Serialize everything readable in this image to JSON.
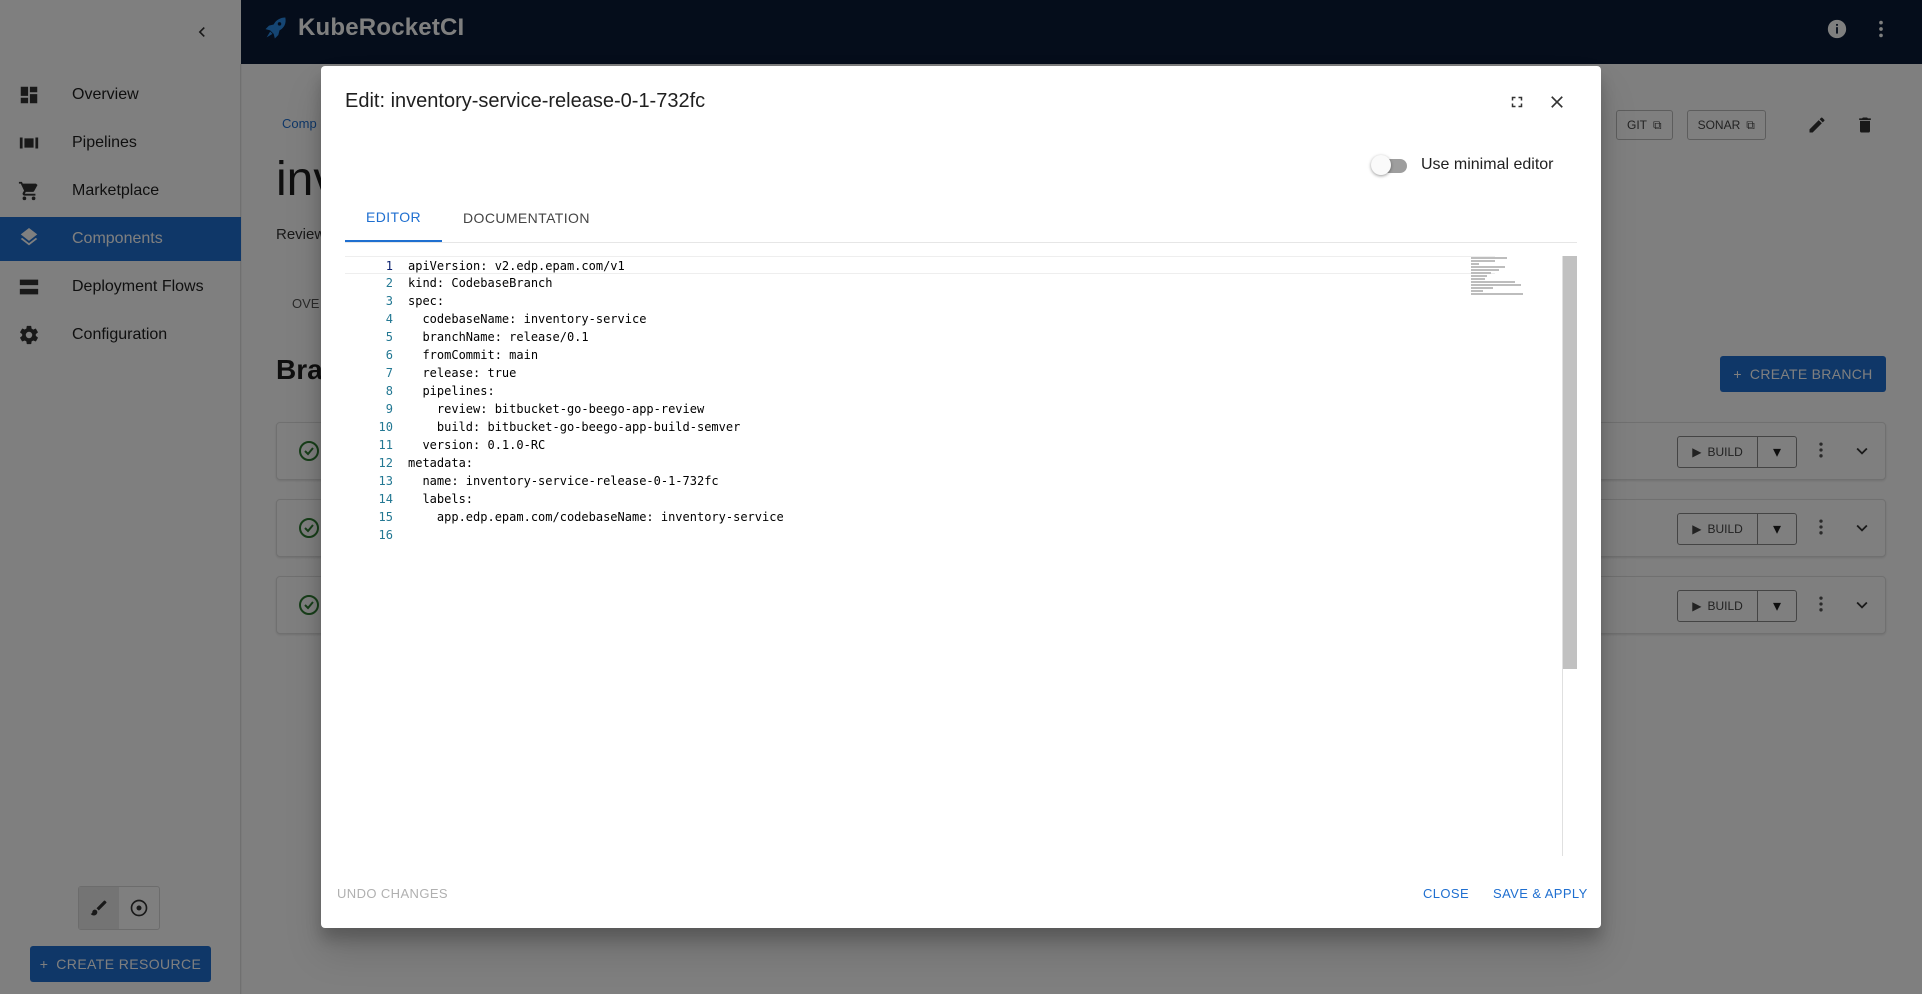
{
  "app": {
    "title": "KubeRocketCI"
  },
  "sidebar": {
    "items": [
      {
        "label": "Overview",
        "icon": "dashboard-icon"
      },
      {
        "label": "Pipelines",
        "icon": "pipelines-icon"
      },
      {
        "label": "Marketplace",
        "icon": "cart-icon"
      },
      {
        "label": "Components",
        "icon": "layers-icon",
        "active": true
      },
      {
        "label": "Deployment Flows",
        "icon": "storage-icon"
      },
      {
        "label": "Configuration",
        "icon": "gear-icon"
      }
    ],
    "create_resource": "CREATE RESOURCE"
  },
  "main": {
    "breadcrumb": "Comp",
    "title": "inv",
    "subtitle": "Review",
    "tab": "OVE",
    "section": "Bra",
    "header_buttons": [
      "GIT",
      "SONAR"
    ],
    "create_branch": "CREATE BRANCH",
    "build_label": "BUILD"
  },
  "dialog": {
    "title": "Edit: inventory-service-release-0-1-732fc",
    "minimal_editor_label": "Use minimal editor",
    "minimal_editor_on": false,
    "tabs": [
      {
        "label": "EDITOR",
        "active": true
      },
      {
        "label": "DOCUMENTATION",
        "active": false
      }
    ],
    "code_lines": [
      {
        "n": "1",
        "text": "apiVersion: v2.edp.epam.com/v1"
      },
      {
        "n": "2",
        "text": "kind: CodebaseBranch"
      },
      {
        "n": "3",
        "text": "spec:"
      },
      {
        "n": "4",
        "text": "  codebaseName: inventory-service"
      },
      {
        "n": "5",
        "text": "  branchName: release/0.1"
      },
      {
        "n": "6",
        "text": "  fromCommit: main"
      },
      {
        "n": "7",
        "text": "  release: true"
      },
      {
        "n": "8",
        "text": "  pipelines:"
      },
      {
        "n": "9",
        "text": "    review: bitbucket-go-beego-app-review"
      },
      {
        "n": "10",
        "text": "    build: bitbucket-go-beego-app-build-semver"
      },
      {
        "n": "11",
        "text": "  version: 0.1.0-RC"
      },
      {
        "n": "12",
        "text": "metadata:"
      },
      {
        "n": "13",
        "text": "  name: inventory-service-release-0-1-732fc"
      },
      {
        "n": "14",
        "text": "  labels:"
      },
      {
        "n": "15",
        "text": "    app.edp.epam.com/codebaseName: inventory-service"
      },
      {
        "n": "16",
        "text": ""
      }
    ],
    "actions": {
      "undo": "UNDO CHANGES",
      "close": "CLOSE",
      "save": "SAVE & APPLY"
    }
  },
  "colors": {
    "accent": "#1f6fd0",
    "topbar": "#0b1b36",
    "success": "#2e7d32"
  }
}
